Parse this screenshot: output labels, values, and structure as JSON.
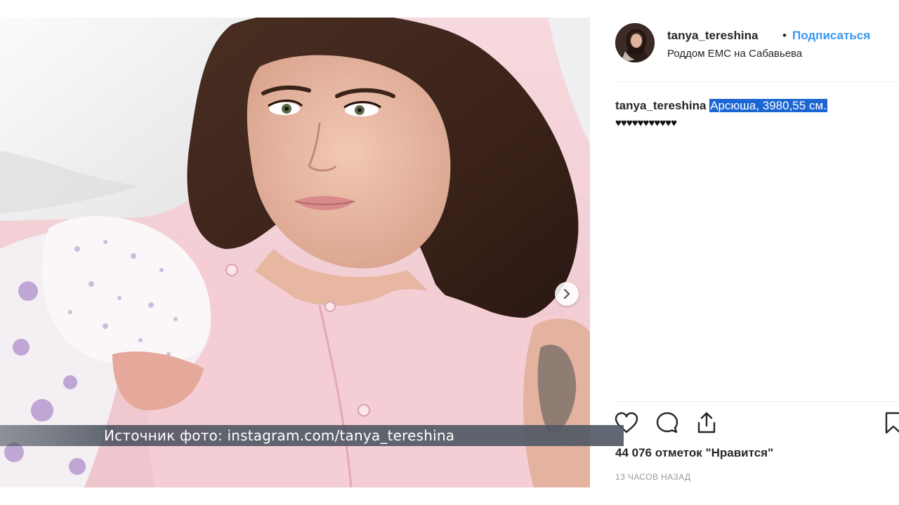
{
  "post": {
    "username": "tanya_tereshina",
    "separator": "•",
    "follow_label": "Подписаться",
    "location": "Роддом ЕМС на Сабавьева"
  },
  "caption": {
    "username": "tanya_tereshina",
    "text": "Арсюша, 3980,55 см.",
    "hearts": "♥♥♥♥♥♥♥♥♥♥♥"
  },
  "actions": {
    "like_icon": "heart-icon",
    "comment_icon": "comment-icon",
    "share_icon": "share-icon",
    "save_icon": "bookmark-icon"
  },
  "stats": {
    "likes": "44 076 отметок \"Нравится\"",
    "time_ago": "13 ЧАСОВ НАЗАД"
  },
  "overlay": {
    "source_text": "Источник фото: instagram.com/tanya_tereshina"
  },
  "colors": {
    "accent": "#3897f0",
    "selection": "#1b66d2",
    "text": "#262626",
    "muted": "#999999"
  }
}
